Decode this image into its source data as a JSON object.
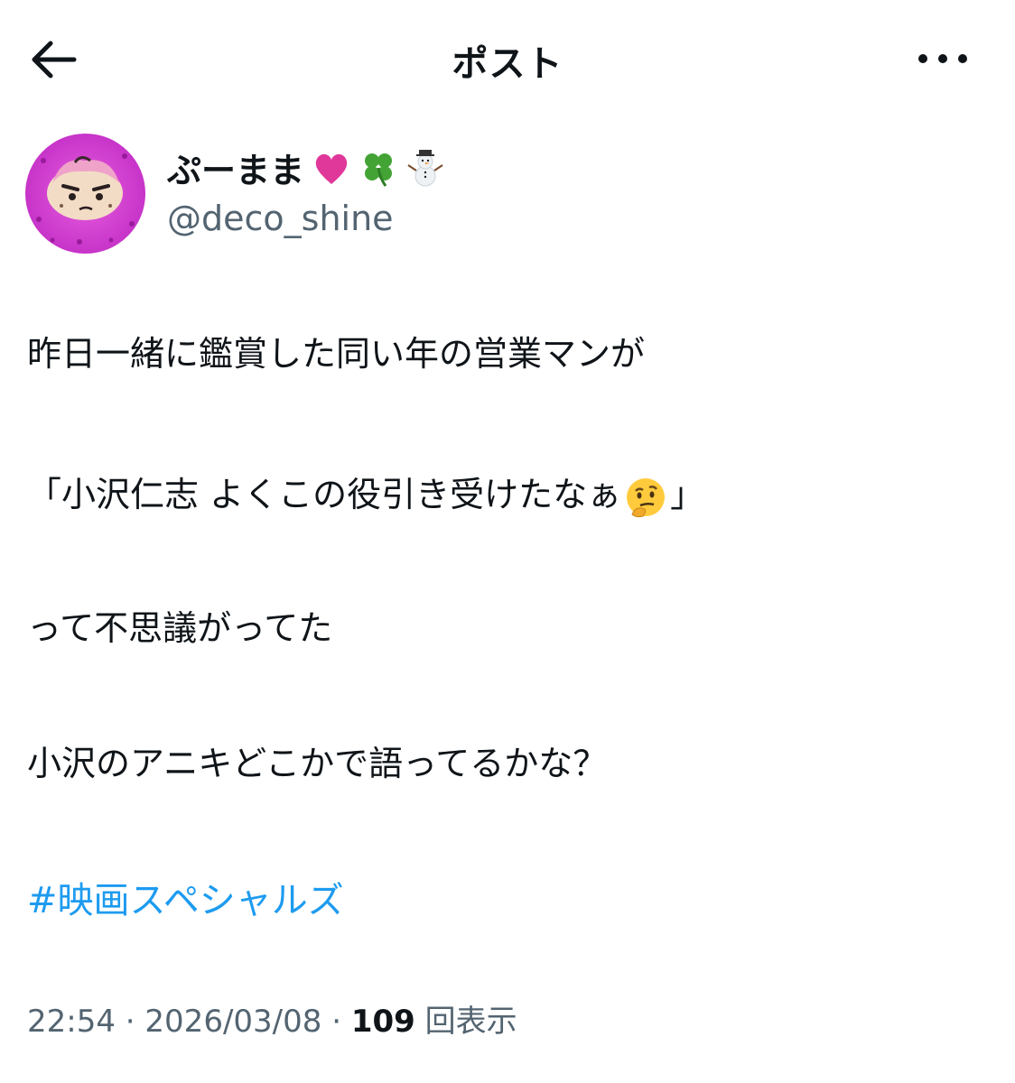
{
  "header": {
    "back_icon": "arrow-left-icon",
    "title": "ポスト",
    "more_icon": "more-horizontal-icon"
  },
  "author": {
    "avatar_icon": "avatar-image",
    "display_name": "ぷーまま",
    "name_emojis": [
      "pink-heart-icon",
      "four-leaf-clover-icon",
      "snowman-icon"
    ],
    "handle": "@deco_shine"
  },
  "tweet": {
    "lines": [
      "昨日一緒に鑑賞した同い年の営業マンが",
      "「小沢仁志 よくこの役引き受けたなぁ",
      "」",
      "って不思議がってた",
      "小沢のアニキどこかで語ってるかな？"
    ],
    "inline_emoji": "thinking-face-icon",
    "hashtag": "#映画スペシャルズ"
  },
  "meta": {
    "time": "22:54",
    "separator": "·",
    "date": "2026/03/08",
    "views_count": "109",
    "views_label": "回表示"
  },
  "colors": {
    "text": "#0f1419",
    "secondary": "#536471",
    "link": "#1d9bf0",
    "heart": "#e0389a"
  }
}
